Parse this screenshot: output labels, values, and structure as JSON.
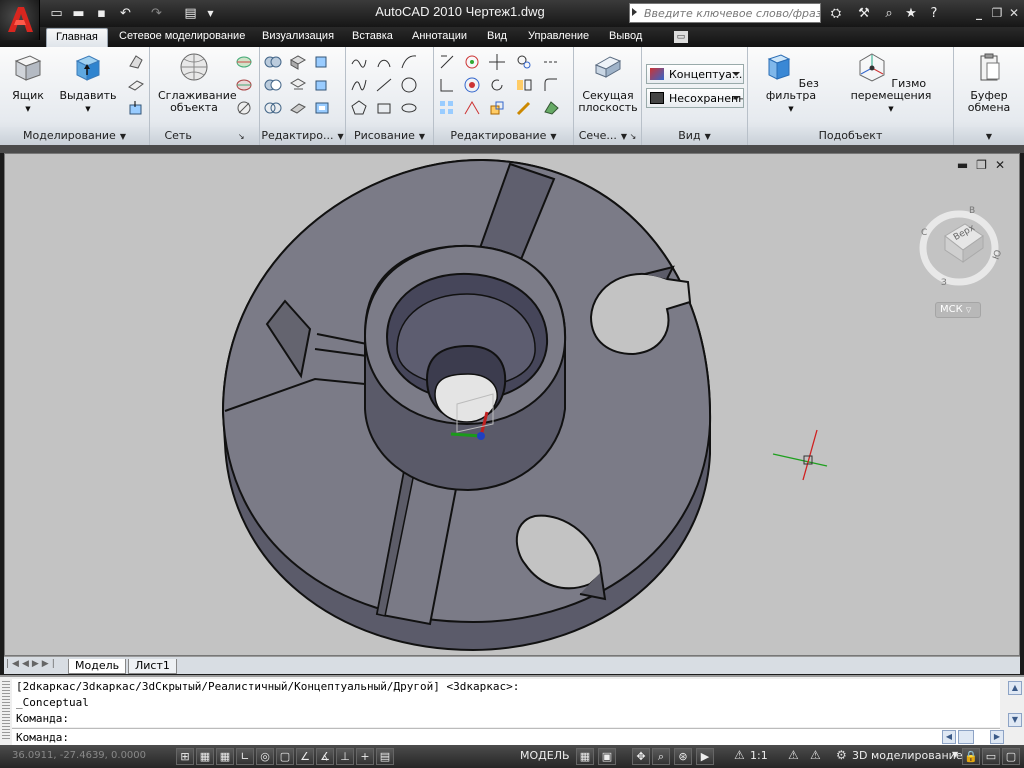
{
  "window": {
    "title": "AutoCAD 2010    Чертеж1.dwg",
    "search_placeholder": "Введите ключевое слово/фразу"
  },
  "tabs": [
    "Главная",
    "Сетевое моделирование",
    "Визуализация",
    "Вставка",
    "Аннотации",
    "Вид",
    "Управление",
    "Вывод"
  ],
  "ribbon": {
    "modeling": {
      "label": "Моделирование",
      "box": "Ящик",
      "extrude": "Выдавить"
    },
    "mesh": {
      "label": "Сеть",
      "smooth": "Сглаживание объекта"
    },
    "solid_edit": {
      "label": "Редактиро..."
    },
    "draw": {
      "label": "Рисование"
    },
    "modify": {
      "label": "Редактирование"
    },
    "section": {
      "label": "Сече...",
      "plane": "Секущая плоскость"
    },
    "view": {
      "label": "Вид",
      "visual_style": "Концептуа...",
      "named_view": "Несохраненн"
    },
    "subobject": {
      "label": "Подобъект",
      "no_filter": "Без фильтра",
      "gizmo": "Гизмо перемещения"
    },
    "clipboard": {
      "label": "Буфер обмена"
    }
  },
  "viewcube": {
    "face": "Верх",
    "compass": [
      "В",
      "Ю",
      "З",
      "С"
    ],
    "ucs": "МСК"
  },
  "layout_tabs": [
    "Модель",
    "Лист1"
  ],
  "command": {
    "history": [
      "[2dкаркас/3dкаркас/3dСкрытый/Реалистичный/Концептуальный/Другой] <3dкаркас>:",
      "_Conceptual",
      "Команда:"
    ],
    "prompt": "Команда:"
  },
  "status": {
    "coords": "36.0911, -27.4639, 0.0000",
    "model": "МОДЕЛЬ",
    "scale": "1:1",
    "workspace": "3D моделирование"
  },
  "colors": {
    "viewport": "#c3c3c3",
    "solid": "#7c7c87",
    "ribbon": "#e6eaef"
  }
}
